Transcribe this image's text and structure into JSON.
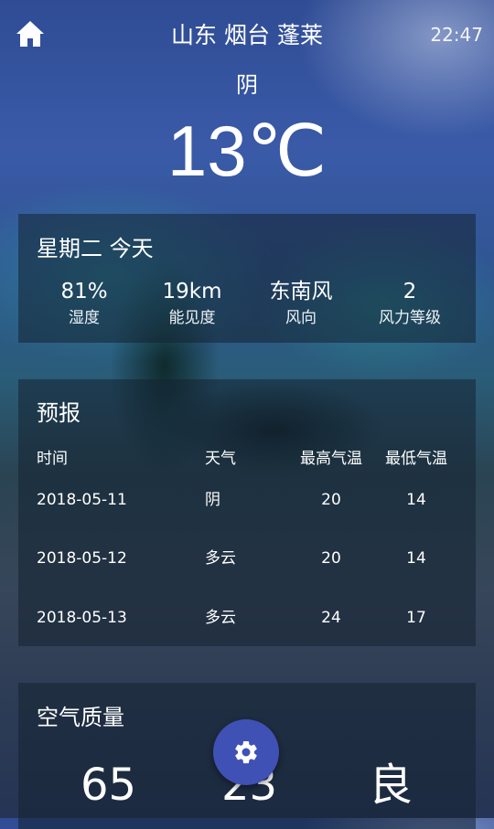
{
  "header": {
    "home_icon": "home-icon",
    "location": "山东 烟台 蓬莱",
    "time": "22:47"
  },
  "current": {
    "condition": "阴",
    "temperature": "13℃"
  },
  "today": {
    "title": "星期二 今天",
    "stats": [
      {
        "value": "81%",
        "label": "湿度"
      },
      {
        "value": "19km",
        "label": "能见度"
      },
      {
        "value": "东南风",
        "label": "风向"
      },
      {
        "value": "2",
        "label": "风力等级"
      }
    ]
  },
  "forecast": {
    "title": "预报",
    "columns": [
      "时间",
      "天气",
      "最高气温",
      "最低气温"
    ],
    "rows": [
      {
        "date": "2018-05-11",
        "weather": "阴",
        "high": "20",
        "low": "14"
      },
      {
        "date": "2018-05-12",
        "weather": "多云",
        "high": "20",
        "low": "14"
      },
      {
        "date": "2018-05-13",
        "weather": "多云",
        "high": "24",
        "low": "17"
      }
    ]
  },
  "air_quality": {
    "title": "空气质量",
    "values": [
      "65",
      "23",
      "良"
    ]
  },
  "fab": {
    "icon": "gear-icon"
  }
}
